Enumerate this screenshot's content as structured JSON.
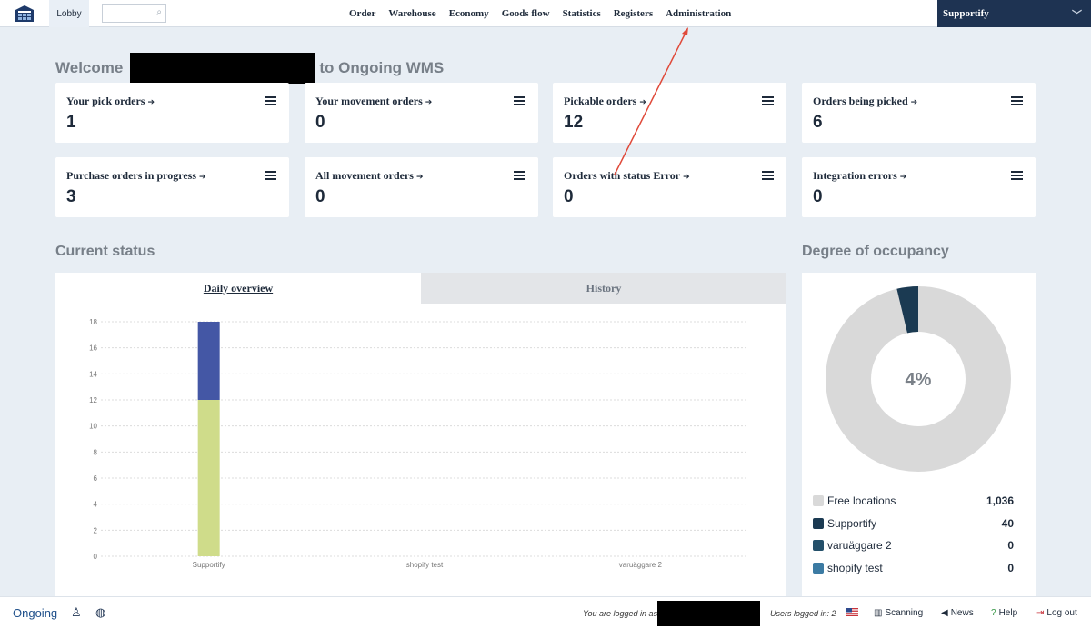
{
  "nav": {
    "lobby": "Lobby",
    "search_placeholder": "",
    "menu": [
      "Order",
      "Warehouse",
      "Economy",
      "Goods flow",
      "Statistics",
      "Registers",
      "Administration"
    ],
    "account": "Supportify"
  },
  "welcome": {
    "prefix": "Welcome",
    "suffix": "to Ongoing WMS"
  },
  "cards": [
    {
      "title": "Your pick orders",
      "value": "1"
    },
    {
      "title": "Your movement orders",
      "value": "0"
    },
    {
      "title": "Pickable orders",
      "value": "12"
    },
    {
      "title": "Orders being picked",
      "value": "6"
    },
    {
      "title": "Purchase orders in progress",
      "value": "3"
    },
    {
      "title": "All movement orders",
      "value": "0"
    },
    {
      "title": "Orders with status Error",
      "value": "0"
    },
    {
      "title": "Integration errors",
      "value": "0"
    }
  ],
  "current_status": {
    "title": "Current status",
    "tabs": [
      "Daily overview",
      "History"
    ]
  },
  "occupancy": {
    "title": "Degree of occupancy",
    "center_label": "4%",
    "legend": [
      {
        "label": "Free locations",
        "value": "1,036",
        "color": "#d9d9d9"
      },
      {
        "label": "Supportify",
        "value": "40",
        "color": "#1b3a52"
      },
      {
        "label": "varuäggare 2",
        "value": "0",
        "color": "#24506a"
      },
      {
        "label": "shopify test",
        "value": "0",
        "color": "#3c7ba3"
      }
    ]
  },
  "chart_data": {
    "type": "bar",
    "stacked": true,
    "categories": [
      "Supportify",
      "shopify test",
      "varuäggare 2"
    ],
    "series": [
      {
        "values": [
          12,
          0,
          0
        ],
        "color": "#cfdc8a"
      },
      {
        "values": [
          6,
          0,
          0
        ],
        "color": "#4457a5"
      }
    ],
    "ylim": [
      0,
      18
    ],
    "yticks": [
      0,
      2,
      4,
      6,
      8,
      10,
      12,
      14,
      16,
      18
    ],
    "grid": true
  },
  "footer": {
    "brand": "Ongoing",
    "logged_in_as": "You are logged in as:",
    "users_logged_in": "Users logged in: 2",
    "scanning": "Scanning",
    "news": "News",
    "help": "Help",
    "logout": "Log out"
  }
}
